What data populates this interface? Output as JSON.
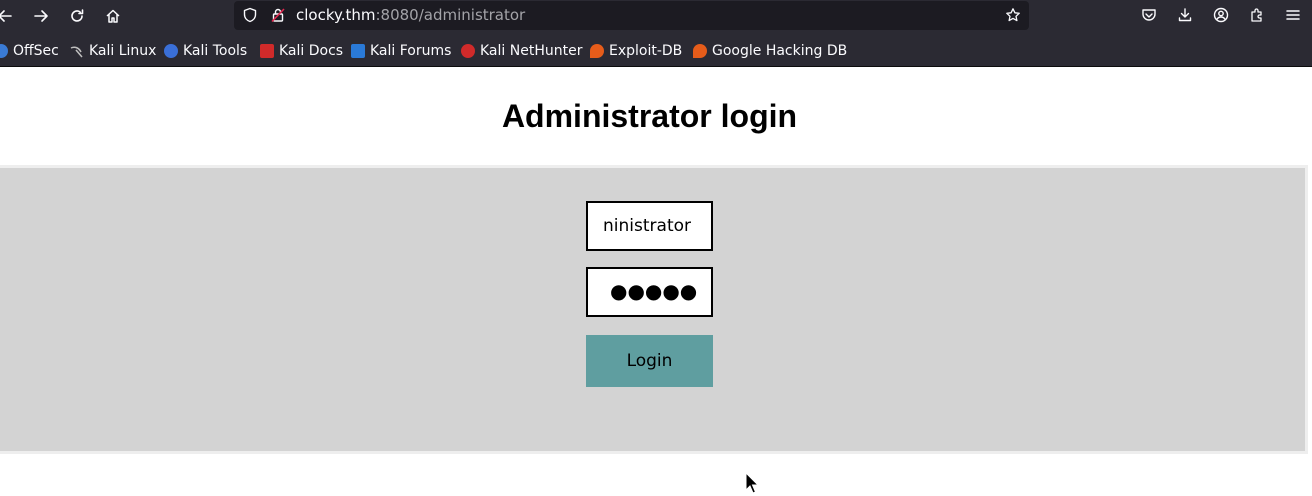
{
  "browser": {
    "url_host": "clocky.thm",
    "url_rest": ":8080/administrator",
    "icons": [
      "back-icon",
      "forward-icon",
      "reload-icon",
      "home-icon",
      "shield-icon",
      "lock-icon",
      "star-icon",
      "pocket-icon",
      "download-icon",
      "account-icon",
      "extensions-icon",
      "menu-icon"
    ],
    "bookmarks": [
      {
        "label": "OffSec",
        "color": "#3a7bd5"
      },
      {
        "label": "Kali Linux",
        "color": "#8a8a8a"
      },
      {
        "label": "Kali Tools",
        "color": "#3a6fd8"
      },
      {
        "label": "Kali Docs",
        "color": "#d02a2a"
      },
      {
        "label": "Kali Forums",
        "color": "#2a7ad8"
      },
      {
        "label": "Kali NetHunter",
        "color": "#d02a2a"
      },
      {
        "label": "Exploit-DB",
        "color": "#e65c1a"
      },
      {
        "label": "Google Hacking DB",
        "color": "#e65c1a"
      }
    ]
  },
  "page": {
    "title": "Administrator login",
    "username_value": "ninistrator",
    "password_mask": "●●●●●",
    "login_label": "Login",
    "panel_color": "#d3d3d3",
    "button_color": "#5f9ea0"
  }
}
